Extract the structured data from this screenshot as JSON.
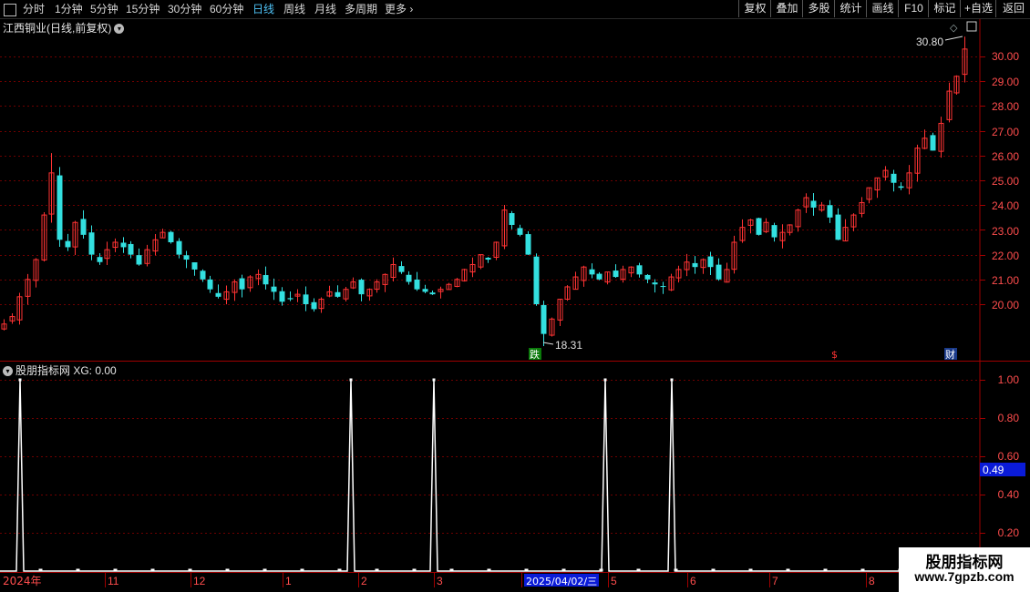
{
  "toolbar": {
    "periods": [
      "分时",
      "1分钟",
      "5分钟",
      "15分钟",
      "30分钟",
      "60分钟",
      "日线",
      "周线",
      "月线",
      "多周期",
      "更多"
    ],
    "active": "日线",
    "right_buttons": [
      "复权",
      "叠加",
      "多股",
      "统计",
      "画线",
      "F10",
      "标记",
      "+自选",
      "返回"
    ]
  },
  "chart_title": "江西铜业(日线,前复权)",
  "indicator_title": "股朋指标网 XG: 0.00",
  "price_axis": [
    "30.00",
    "29.00",
    "28.00",
    "27.00",
    "26.00",
    "25.00",
    "24.00",
    "23.00",
    "22.00",
    "21.00",
    "20.00"
  ],
  "indicator_axis": [
    "1.00",
    "0.80",
    "0.60",
    "0.40",
    "0.20"
  ],
  "indicator_current": "0.49",
  "annotations": {
    "high": "30.80",
    "low": "18.31",
    "mark_die": "跌",
    "mark_s": "$",
    "mark_cai": "财"
  },
  "date_axis": [
    "2024年",
    "11",
    "12",
    "1",
    "2",
    "3",
    "2025/04/02/三",
    "5",
    "6",
    "7",
    "8"
  ],
  "watermark": {
    "line1": "股朋指标网",
    "line2": "www.7gpzb.com"
  },
  "colors": {
    "up": "#ff3333",
    "down": "#33e0e0",
    "grid": "#7a0000",
    "axis": "#8b0000",
    "accent": "#4fc3f7"
  },
  "chart_data": {
    "type": "candlestick",
    "title": "江西铜业(日线,前复权)",
    "x_labels": [
      "2024年",
      "11",
      "12",
      "1",
      "2",
      "3",
      "2025/04/02/三",
      "5",
      "6",
      "7",
      "8"
    ],
    "ylim": [
      18.2,
      30.9
    ],
    "high": 30.8,
    "low": 18.31,
    "close_path": [
      19.2,
      19.5,
      20.3,
      21.0,
      21.8,
      23.6,
      25.3,
      22.6,
      22.3,
      23.3,
      22.8,
      22.0,
      21.7,
      22.2,
      22.5,
      22.3,
      22.0,
      21.6,
      22.2,
      22.6,
      22.9,
      22.5,
      22.0,
      21.8,
      21.4,
      21.0,
      20.6,
      20.3,
      20.5,
      20.9,
      20.6,
      21.1,
      21.2,
      20.8,
      20.5,
      20.1,
      20.2,
      20.4,
      20.0,
      19.8,
      20.2,
      20.5,
      20.3,
      20.6,
      20.9,
      20.4,
      20.6,
      20.9,
      21.2,
      21.6,
      21.3,
      20.9,
      20.6,
      20.5,
      20.4,
      20.6,
      20.8,
      21.0,
      21.4,
      21.6,
      22.0,
      21.8,
      22.5,
      23.8,
      23.2,
      22.8,
      22.0,
      20.0,
      18.8,
      19.4,
      20.2,
      20.7,
      21.1,
      21.5,
      21.2,
      21.0,
      21.3,
      21.1,
      21.4,
      21.5,
      21.2,
      21.0,
      20.8,
      20.7,
      21.1,
      21.4,
      21.7,
      21.5,
      21.8,
      21.5,
      21.0,
      21.4,
      22.5,
      23.1,
      23.4,
      22.8,
      23.3,
      22.7,
      22.9,
      23.2,
      23.8,
      24.3,
      23.9,
      24.0,
      23.5,
      22.6,
      23.1,
      23.6,
      24.1,
      24.7,
      25.1,
      25.4,
      24.9,
      24.7,
      25.3,
      26.3,
      26.7,
      26.2,
      27.3,
      28.6,
      29.2,
      30.3
    ],
    "indicator": {
      "name": "XG",
      "ylim": [
        0,
        1.1
      ],
      "current": 0.49,
      "spike_positions": [
        0.018,
        0.355,
        0.44,
        0.615,
        0.683
      ]
    }
  }
}
